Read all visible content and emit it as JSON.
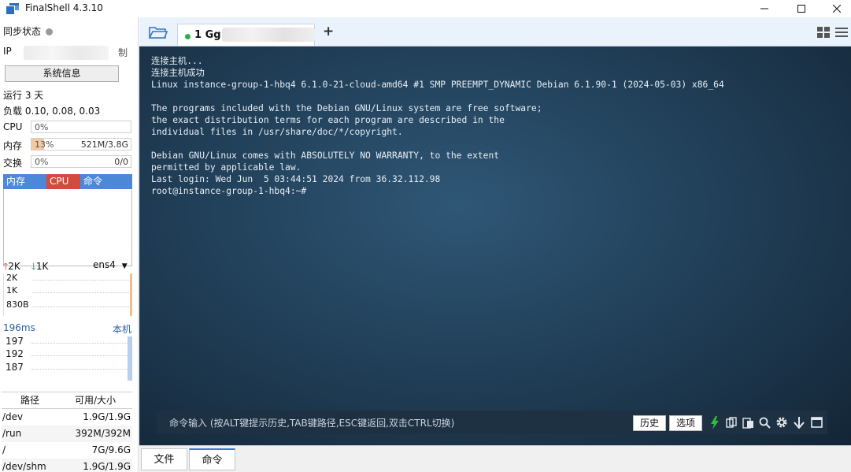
{
  "window": {
    "title": "FinalShell 4.3.10"
  },
  "sidebar": {
    "sync_label": "同步状态",
    "ip_label": "IP",
    "ip_suffix": "制",
    "sysinfo_button": "系统信息",
    "uptime": "运行 3 天",
    "load": "负载 0.10, 0.08, 0.03",
    "cpu": {
      "label": "CPU",
      "percent": "0%",
      "value": 0
    },
    "mem": {
      "label": "内存",
      "percent": "13%",
      "amount": "521M/3.8G",
      "value": 13
    },
    "swap": {
      "label": "交换",
      "percent": "0%",
      "amount": "0/0",
      "value": 0
    },
    "process_headers": [
      "内存",
      "CPU",
      "命令"
    ],
    "net": {
      "up": "2K",
      "down": "1K",
      "interface": "ens4",
      "scale": [
        "2K",
        "1K",
        "830B"
      ]
    },
    "ping": {
      "latency": "196ms",
      "target": "本机",
      "scale": [
        "197",
        "192",
        "187"
      ]
    },
    "fs": {
      "headers": [
        "路径",
        "可用/大小"
      ],
      "rows": [
        {
          "path": "/dev",
          "size": "1.9G/1.9G"
        },
        {
          "path": "/run",
          "size": "392M/392M"
        },
        {
          "path": "/",
          "size": "7G/9.6G"
        },
        {
          "path": "/dev/shm",
          "size": "1.9G/1.9G"
        }
      ]
    }
  },
  "tabs": {
    "active_label": "1 Gg",
    "add": "+"
  },
  "terminal": {
    "lines": [
      "连接主机...",
      "连接主机成功",
      "Linux instance-group-1-hbq4 6.1.0-21-cloud-amd64 #1 SMP PREEMPT_DYNAMIC Debian 6.1.90-1 (2024-05-03) x86_64",
      "",
      "The programs included with the Debian GNU/Linux system are free software;",
      "the exact distribution terms for each program are described in the",
      "individual files in /usr/share/doc/*/copyright.",
      "",
      "Debian GNU/Linux comes with ABSOLUTELY NO WARRANTY, to the extent",
      "permitted by applicable law.",
      "Last login: Wed Jun  5 03:44:51 2024 from 36.32.112.98",
      "root@instance-group-1-hbq4:~#"
    ]
  },
  "cmdbar": {
    "placeholder": "命令输入 (按ALT键提示历史,TAB键路径,ESC键返回,双击CTRL切换)",
    "history": "历史",
    "options": "选项"
  },
  "bottom_tabs": [
    "文件",
    "命令"
  ]
}
